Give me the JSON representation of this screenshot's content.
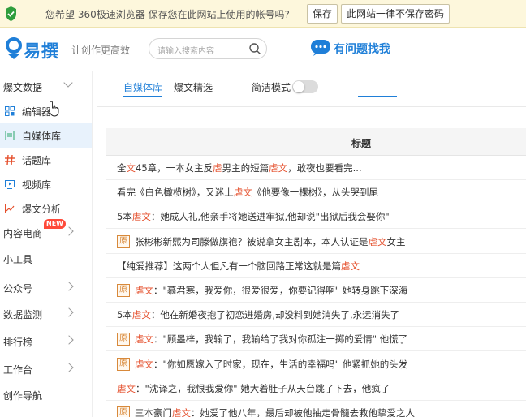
{
  "password_bar": {
    "message": "您希望 360极速浏览器 保存您在此网站上使用的帐号吗?",
    "save_label": "保存",
    "never_label": "此网站一律不保存密码"
  },
  "header": {
    "logo_text": "易撰",
    "slogan": "让创作更高效",
    "search_placeholder": "请输入搜索内容",
    "help_text": "有问题找我"
  },
  "sidebar": {
    "group_label": "爆文数据",
    "sub_items": [
      {
        "label": "编辑器",
        "icon": "grid-icon"
      },
      {
        "label": "自媒体库",
        "icon": "document-icon"
      },
      {
        "label": "话题库",
        "icon": "hashtag-icon"
      },
      {
        "label": "视频库",
        "icon": "video-icon"
      },
      {
        "label": "爆文分析",
        "icon": "chart-icon"
      }
    ],
    "items": [
      {
        "label": "内容电商",
        "badge": "NEW",
        "chevron": true
      },
      {
        "label": "小工具",
        "chevron": false
      },
      {
        "label": "公众号",
        "chevron": true
      },
      {
        "label": "数据监测",
        "chevron": true
      },
      {
        "label": "排行榜",
        "chevron": true
      },
      {
        "label": "工作台",
        "chevron": true
      },
      {
        "label": "创作导航",
        "chevron": false
      }
    ]
  },
  "tabs": {
    "items": [
      "自媒体库",
      "爆文精选"
    ],
    "toggle_label": "简洁模式"
  },
  "table": {
    "header": "标题",
    "rows": [
      {
        "orig": false,
        "parts": [
          [
            "全",
            0
          ],
          [
            "文",
            1
          ],
          [
            "45章，一本女主反",
            0
          ],
          [
            "虐",
            1
          ],
          [
            "男主的短篇",
            0
          ],
          [
            "虐文",
            1
          ],
          [
            "，敢夜也要看完...",
            0
          ]
        ]
      },
      {
        "orig": false,
        "parts": [
          [
            "看完《白色橄榄树》，又迷上",
            0
          ],
          [
            "虐文",
            1
          ],
          [
            "《他要像一棵树》，从头哭到尾",
            0
          ]
        ]
      },
      {
        "orig": false,
        "parts": [
          [
            "5本",
            0
          ],
          [
            "虐文",
            1
          ],
          [
            "：她成人礼,他亲手将她送进牢狱,他却说\"出狱后我会娶你\"",
            0
          ]
        ]
      },
      {
        "orig": true,
        "parts": [
          [
            "张彬彬新熙为司滕做旗袍？被说拿女主剧本，本人认证是",
            0
          ],
          [
            "虐文",
            1
          ],
          [
            "女主",
            0
          ]
        ]
      },
      {
        "orig": false,
        "parts": [
          [
            "【纯爱推荐】这两个人但凡有一个脑回路正常这就是篇",
            0
          ],
          [
            "虐文",
            1
          ]
        ]
      },
      {
        "orig": true,
        "parts": [
          [
            "虐文",
            1
          ],
          [
            "：\"慕君寒，我爱你，很爱很爱，你要记得啊\" 她转身跳下深海",
            0
          ]
        ]
      },
      {
        "orig": false,
        "parts": [
          [
            "5本",
            0
          ],
          [
            "虐文",
            1
          ],
          [
            "：他在新婚夜抱了初恋进婚房,却没料到她消失了,永远消失了",
            0
          ]
        ]
      },
      {
        "orig": true,
        "parts": [
          [
            "虐文",
            1
          ],
          [
            "：\"顾墨梓，我输了，我输给了我对你孤注一掷的爱情\" 他慌了",
            0
          ]
        ]
      },
      {
        "orig": true,
        "parts": [
          [
            "虐文",
            1
          ],
          [
            "：\"你如愿嫁入了时家，现在，生活的幸福吗\" 他紧抓她的头发",
            0
          ]
        ]
      },
      {
        "orig": false,
        "parts": [
          [
            "虐文",
            1
          ],
          [
            "：\"沈译之，我恨我爱你\" 她大着肚子从天台跳了下去，他疯了",
            0
          ]
        ]
      },
      {
        "orig": true,
        "parts": [
          [
            "三本豪门",
            0
          ],
          [
            "虐文",
            1
          ],
          [
            "：她爱了他八年，最后却被他抽走骨髓去救他挚爱之人",
            0
          ]
        ]
      }
    ]
  },
  "colors": {
    "accent": "#1f7fd8",
    "highlight": "#e5502d",
    "badge": "#ff4a3a"
  }
}
